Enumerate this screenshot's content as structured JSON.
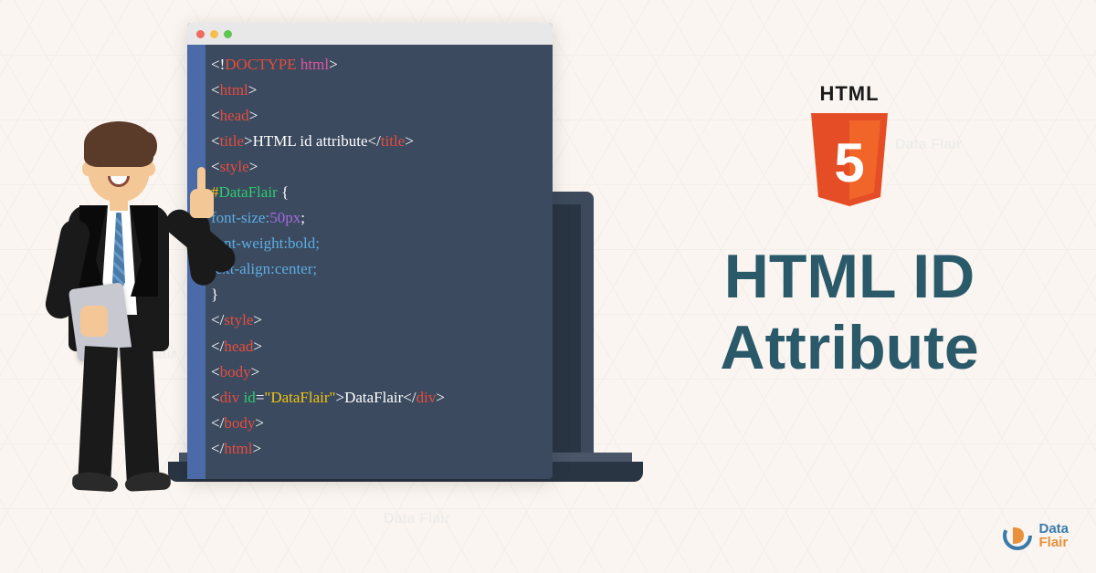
{
  "html5": {
    "label": "HTML",
    "number": "5"
  },
  "title": {
    "line1": "HTML ID",
    "line2": "Attribute"
  },
  "code": {
    "l1": {
      "a": "<!",
      "b": "DOCTYPE",
      "c": " html",
      "d": ">"
    },
    "l2": {
      "a": "<",
      "b": "html",
      "c": ">"
    },
    "l3": {
      "a": "<",
      "b": "head",
      "c": ">"
    },
    "l4": {
      "a": "<",
      "b": "title",
      "c": ">",
      "d": "HTML id attribute",
      "e": "</",
      "f": "title",
      "g": ">"
    },
    "l5": {
      "a": "<",
      "b": "style",
      "c": ">"
    },
    "l6": {
      "a": "#",
      "b": "DataFlair",
      "c": " {"
    },
    "l7": {
      "a": "font-size:",
      "b": "50px",
      "c": ";"
    },
    "l8": {
      "a": "font-weight:bold;"
    },
    "l9": {
      "a": "text-align:center;"
    },
    "l10": {
      "a": "}"
    },
    "l11": {
      "a": "</",
      "b": "style",
      "c": ">"
    },
    "l12": {
      "a": "</",
      "b": "head",
      "c": ">"
    },
    "l13": {
      "a": "<",
      "b": "body",
      "c": ">"
    },
    "l14": {
      "a": "<",
      "b": "div",
      "c": " id",
      "d": "=",
      "e": "\"DataFlair\"",
      "f": ">",
      "g": "DataFlair",
      "h": "</",
      "i": "div",
      "j": ">"
    },
    "l15": {
      "a": "</",
      "b": "body",
      "c": ">"
    },
    "l16": {
      "a": "</",
      "b": "html",
      "c": ">"
    }
  },
  "logo": {
    "text1": "Data",
    "text2": "Flair"
  }
}
